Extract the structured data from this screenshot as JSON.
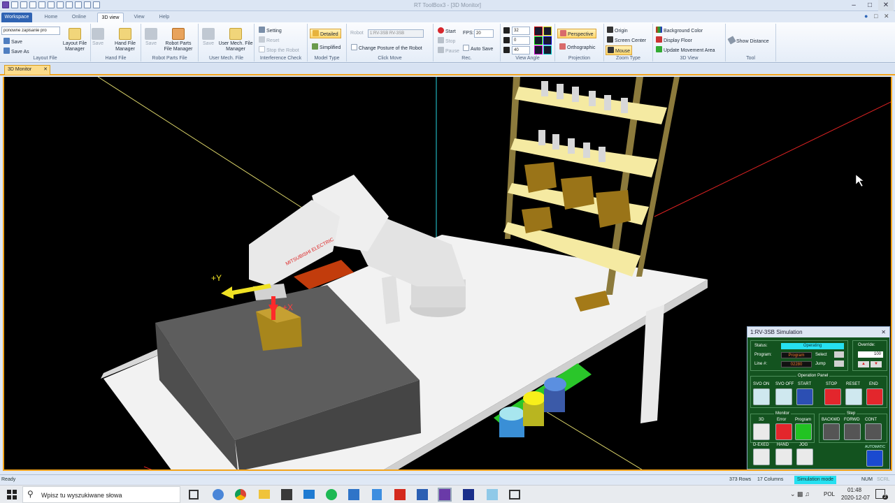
{
  "window": {
    "title": "RT ToolBox3 - [3D Monitor]"
  },
  "tabs": [
    "Workspace",
    "Home",
    "Online",
    "3D view",
    "View",
    "Help"
  ],
  "ribbon": {
    "layout": {
      "dropdown": "ponowne zapisanie pro",
      "save": "Save",
      "save_as": "Save As",
      "manager": "Layout File Manager",
      "label": "Layout File"
    },
    "hand": {
      "save": "Save",
      "manager": "Hand File Manager",
      "label": "Hand File"
    },
    "parts": {
      "save": "Save",
      "manager": "Robot Parts File Manager",
      "label": "Robot Parts File"
    },
    "usermech": {
      "save": "Save",
      "manager": "User Mech. File Manager",
      "label": "User Mech. File"
    },
    "interference": {
      "setting": "Setting",
      "reset": "Reset",
      "stop": "Stop the Robot",
      "label": "Interference Check"
    },
    "model": {
      "detailed": "Detailed",
      "simplified": "Simplified",
      "label": "Model Type"
    },
    "click_move": {
      "robot_label": "Robot",
      "robot_value": "1:RV-3SB RV-3SB",
      "change": "Change Posture of the Robot",
      "label": "Click Move"
    },
    "rec": {
      "start": "Start",
      "stop": "Stop",
      "pause": "Pause",
      "fps_label": "FPS:",
      "fps": "20",
      "auto_save": "Auto Save",
      "label": "Rec."
    },
    "view_angle": {
      "x": "32",
      "y": "0",
      "z": "40",
      "label": "View Angle"
    },
    "projection": {
      "perspective": "Perspective",
      "orthographic": "Orthographic",
      "label": "Projection"
    },
    "zoom": {
      "origin": "Origin",
      "screen_center": "Screen Center",
      "mouse": "Mouse",
      "label": "Zoom Type"
    },
    "view3d": {
      "bg": "Background Color",
      "floor": "Display Floor",
      "update": "Update Movement Area",
      "label": "3D View"
    },
    "tool": {
      "distance": "Show Distance",
      "label": "Tool"
    }
  },
  "doc_tab": "3D Monitor",
  "scene": {
    "axis_y": "+Y",
    "axis_x": "+X",
    "brand": "MITSUBISHI ELECTRIC"
  },
  "sim": {
    "title": "1:RV-3SB  Simulation",
    "status_label": "Status:",
    "status": "Operating",
    "program_label": "Program:",
    "program": "Program",
    "line_label": "Line #:",
    "line": "02280",
    "select": "Select",
    "jump": "Jump",
    "override_label": "Override:",
    "override": "100",
    "op_panel": "Operation Panel",
    "svo_on": "SVO ON",
    "svo_off": "SVO OFF",
    "start": "START",
    "stop": "STOP",
    "reset": "RESET",
    "end": "END",
    "monitor": "Monitor",
    "m3d": "3D",
    "error": "Error",
    "step": "Step",
    "backwd": "BACKWD",
    "forwd": "FORWD",
    "cont": "CONT",
    "dexed": "D-EXED",
    "hand": "HAND",
    "jog": "JOG",
    "automatic": "AUTOMATIC"
  },
  "status": {
    "left": "Ready",
    "rows": "373 Rows",
    "cols": "17 Columns",
    "mode": "Simulation mode",
    "num": "NUM",
    "scrl": "SCRL"
  },
  "taskbar": {
    "search": "Wpisz tu wyszukiwane słowa",
    "lang": "POL",
    "time": "01:48",
    "date": "2020-12-07",
    "notif": "2"
  },
  "colors": {
    "accent": "#f3a41b",
    "ribbon_blue": "#2f63b3",
    "sim_bg": "#13531f",
    "status_cyan": "#26e0f0"
  }
}
